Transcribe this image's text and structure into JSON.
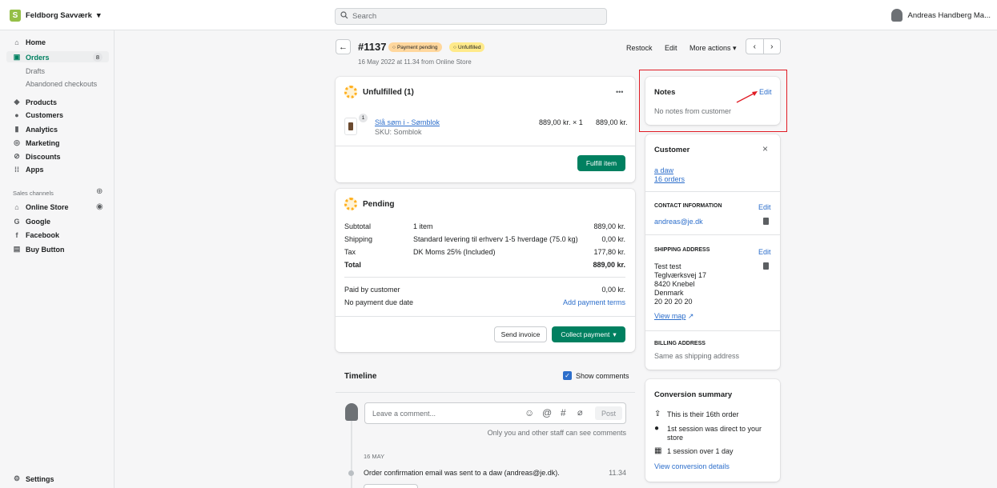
{
  "topbar": {
    "store_name": "Feldborg Savværk",
    "search_placeholder": "Search",
    "user_name": "Andreas Handberg Ma..."
  },
  "sidebar": {
    "home": "Home",
    "orders": "Orders",
    "orders_count": "8",
    "drafts": "Drafts",
    "abandoned": "Abandoned checkouts",
    "products": "Products",
    "customers": "Customers",
    "analytics": "Analytics",
    "marketing": "Marketing",
    "discounts": "Discounts",
    "apps": "Apps",
    "sales_channels": "Sales channels",
    "online_store": "Online Store",
    "google": "Google",
    "facebook": "Facebook",
    "buy_button": "Buy Button",
    "settings": "Settings"
  },
  "header": {
    "order_number": "#1137",
    "payment_badge": "Payment pending",
    "fulfillment_badge": "Unfulfilled",
    "date": "16 May 2022 at 11.34 from Online Store",
    "restock": "Restock",
    "edit": "Edit",
    "more_actions": "More actions"
  },
  "unfulfilled": {
    "title": "Unfulfilled (1)",
    "more": "•••",
    "item_qty": "1",
    "item_name": "Slå søm i - Sømblok",
    "item_sku": "SKU: Somblok",
    "item_price": "889,00 kr. × 1",
    "item_total": "889,00 kr.",
    "fulfill_button": "Fulfill item"
  },
  "pending": {
    "title": "Pending",
    "rows": [
      {
        "label": "Subtotal",
        "desc": "1 item",
        "value": "889,00 kr."
      },
      {
        "label": "Shipping",
        "desc": "Standard levering til erhverv 1-5 hverdage (75.0 kg)",
        "value": "0,00 kr."
      },
      {
        "label": "Tax",
        "desc": "DK Moms 25% (Included)",
        "value": "177,80 kr."
      },
      {
        "label": "Total",
        "desc": "",
        "value": "889,00 kr."
      }
    ],
    "paid_label": "Paid by customer",
    "paid_value": "0,00 kr.",
    "due_label": "No payment due date",
    "add_terms": "Add payment terms",
    "send_invoice": "Send invoice",
    "collect_payment": "Collect payment"
  },
  "timeline": {
    "title": "Timeline",
    "show_comments": "Show comments",
    "comment_placeholder": "Leave a comment...",
    "post": "Post",
    "hint": "Only you and other staff can see comments",
    "date_header": "16 MAY",
    "event_text": "Order confirmation email was sent to a daw (andreas@je.dk).",
    "event_time": "11.34"
  },
  "notes": {
    "title": "Notes",
    "edit": "Edit",
    "text": "No notes from customer"
  },
  "customer": {
    "title": "Customer",
    "close": "×",
    "name": "a daw",
    "orders": "16 orders",
    "contact_header": "CONTACT INFORMATION",
    "contact_edit": "Edit",
    "email": "andreas@je.dk",
    "shipping_header": "SHIPPING ADDRESS",
    "shipping_edit": "Edit",
    "address_lines": [
      "Test test",
      "Teglværksvej 17",
      "8420 Knebel",
      "Denmark",
      "20 20 20 20"
    ],
    "view_map": "View map",
    "billing_header": "BILLING ADDRESS",
    "billing_text": "Same as shipping address"
  },
  "conversion": {
    "title": "Conversion summary",
    "line1": "This is their 16th order",
    "line2a": "1st session was direct to your",
    "line2b": "store",
    "line3": "1 session over 1 day",
    "details": "View conversion details"
  },
  "colors": {
    "accent_green": "#008060",
    "link_blue": "#2c6ecb",
    "highlight_red": "#e01b24"
  }
}
